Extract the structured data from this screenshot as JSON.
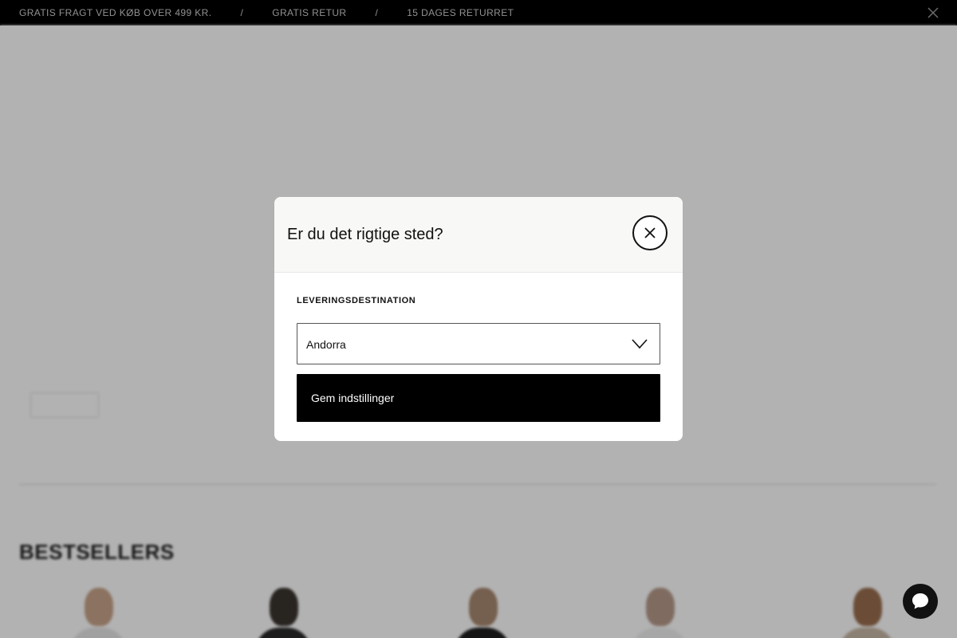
{
  "announcement_bar": {
    "messages": [
      "GRATIS FRAGT VED KØB OVER 499 KR.",
      "GRATIS RETUR",
      "15 DAGES RETURRET"
    ],
    "separator": "/"
  },
  "background_page": {
    "pill_label": "",
    "section_heading": "BESTSELLERS",
    "section_link": ""
  },
  "location_modal": {
    "title": "Er du det rigtige sted?",
    "field_label": "LEVERINGSDESTINATION",
    "selected_country": "Andorra",
    "save_label": "Gem indstillinger"
  },
  "icons": {
    "close": "close-icon",
    "chevron": "chevron-down-icon",
    "chat": "chat-icon"
  },
  "colors": {
    "primary_button": "#000000",
    "modal_header": "#f8f8f6",
    "overlay": "rgba(0,0,0,0.3)"
  }
}
